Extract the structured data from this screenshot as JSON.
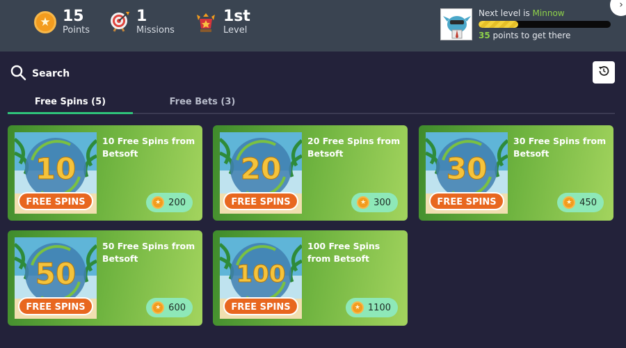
{
  "header": {
    "points": {
      "value": "15",
      "label": "Points"
    },
    "missions": {
      "value": "1",
      "label": "Missions"
    },
    "level": {
      "value": "1st",
      "label": "Level"
    },
    "next_level_prefix": "Next level is",
    "next_level_name": "Minnow",
    "progress_fraction": 0.3,
    "points_needed": "35",
    "points_needed_suffix": "points to get there"
  },
  "search": {
    "label": "Search"
  },
  "tabs": [
    {
      "label": "Free Spins (5)",
      "active": true
    },
    {
      "label": "Free Bets (3)",
      "active": false
    }
  ],
  "cards": [
    {
      "number": "10",
      "badge": "FREE SPINS",
      "title": "10 Free Spins from Betsoft",
      "price": "200"
    },
    {
      "number": "20",
      "badge": "FREE SPINS",
      "title": "20 Free Spins from Betsoft",
      "price": "300"
    },
    {
      "number": "30",
      "badge": "FREE SPINS",
      "title": "30 Free Spins from Betsoft",
      "price": "450"
    },
    {
      "number": "50",
      "badge": "FREE SPINS",
      "title": "50 Free Spins from Betsoft",
      "price": "600"
    },
    {
      "number": "100",
      "badge": "FREE SPINS",
      "title": "100 Free Spins from Betsoft",
      "price": "1100"
    }
  ],
  "colors": {
    "accent_green": "#2fc37a",
    "level_green": "#8fd24a",
    "coin_orange": "#f39c1e"
  },
  "icons": {
    "points": "star-coin-icon",
    "missions": "target-icon",
    "level": "trophy-icon",
    "search": "search-icon",
    "history": "history-icon"
  }
}
